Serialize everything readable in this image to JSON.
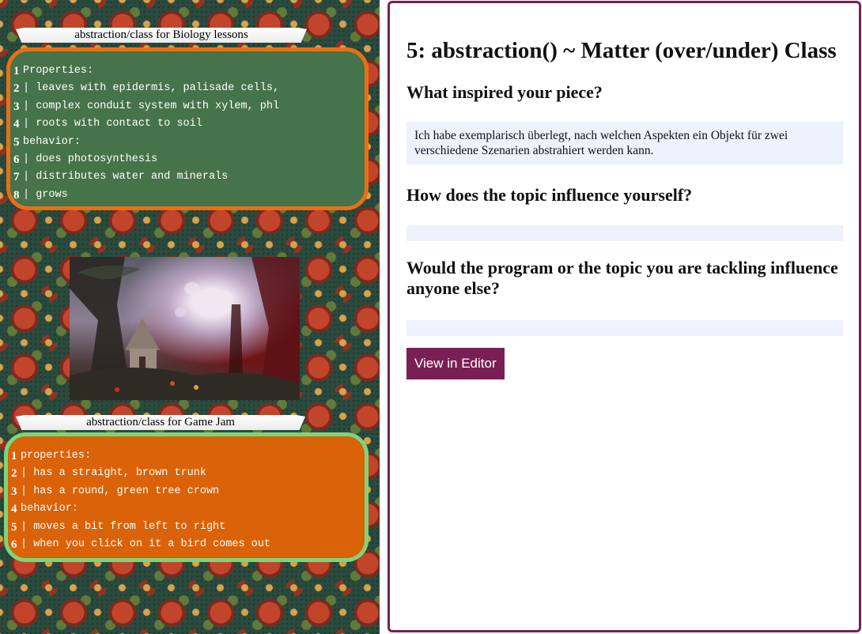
{
  "canvas": {
    "biology": {
      "banner": "abstraction/class for Biology lessons",
      "lines": [
        {
          "n": "1",
          "bar": "",
          "text": "Properties:"
        },
        {
          "n": "2",
          "bar": "|",
          "text": " leaves with epidermis, palisade cells,"
        },
        {
          "n": "3",
          "bar": "|",
          "text": " complex conduit system with xylem, phl"
        },
        {
          "n": "4",
          "bar": "|",
          "text": " roots with contact to soil"
        },
        {
          "n": "5",
          "bar": "",
          "text": "behavior:"
        },
        {
          "n": "6",
          "bar": "|",
          "text": " does photosynthesis"
        },
        {
          "n": "7",
          "bar": "|",
          "text": " distributes water and minerals"
        },
        {
          "n": "8",
          "bar": "|",
          "text": " grows"
        }
      ]
    },
    "gamejam": {
      "banner": "abstraction/class for Game Jam",
      "lines": [
        {
          "n": "1",
          "bar": "",
          "text": "properties:"
        },
        {
          "n": "2",
          "bar": "|",
          "text": " has a straight, brown trunk"
        },
        {
          "n": "3",
          "bar": "|",
          "text": " has a round, green tree crown"
        },
        {
          "n": "4",
          "bar": "",
          "text": "behavior:"
        },
        {
          "n": "5",
          "bar": "|",
          "text": " moves a bit from left to right"
        },
        {
          "n": "6",
          "bar": "|",
          "text": " when you click on it a bird comes out"
        }
      ]
    },
    "colors": {
      "green_box": "#467349",
      "green_border": "#ea6f12",
      "orange_box": "#da6208",
      "orange_border": "#7dd57a"
    }
  },
  "panel": {
    "title": "5: abstraction() ~ Matter (over/under) Class",
    "q1": "What inspired your piece?",
    "a1": "Ich habe exemplarisch überlegt, nach welchen Aspekten ein Objekt für zwei verschiedene Szenarien abstrahiert werden kann.",
    "q2": "How does the topic influence yourself?",
    "a2": "",
    "q3": "Would the program or the topic you are tackling influence anyone else?",
    "a3": "",
    "button_label": "View in Editor",
    "accent": "#7a1f56"
  }
}
